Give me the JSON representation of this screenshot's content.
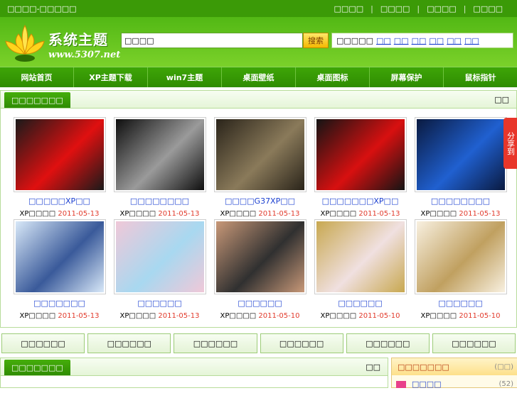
{
  "topbar": {
    "left_text": "□□□□-□□□□□",
    "links": [
      "□□□□",
      "□□□□",
      "□□□□",
      "□□□□"
    ]
  },
  "header": {
    "logo_title": "系统主题",
    "logo_domain": "www.5307.net",
    "search_value": "□□□□",
    "search_button": "搜索",
    "hot_label": "□□□□□",
    "hot_keywords": [
      "□□",
      "□□",
      "□□",
      "□□",
      "□□",
      "□□"
    ]
  },
  "nav": [
    "网站首页",
    "XP主题下载",
    "win7主题",
    "桌面壁纸",
    "桌面图标",
    "屏幕保护",
    "鼠标指针"
  ],
  "panel1": {
    "tab": "□□□□□□□",
    "more": "□□",
    "items": [
      {
        "name": "□□□□□XP□□",
        "type": "XP□□□□",
        "date": "2011-05-13",
        "color1": "#e01010",
        "color2": "#1a1a1a"
      },
      {
        "name": "□□□□□□□□",
        "type": "XP□□□□",
        "date": "2011-05-13",
        "color1": "#9a9a9a",
        "color2": "#0f0f0f"
      },
      {
        "name": "□□□□G37XP□□",
        "type": "XP□□□□",
        "date": "2011-05-13",
        "color1": "#8a7a5a",
        "color2": "#2a241a"
      },
      {
        "name": "□□□□□□□XP□□",
        "type": "XP□□□□",
        "date": "2011-05-13",
        "color1": "#d81010",
        "color2": "#141414"
      },
      {
        "name": "□□□□□□□□",
        "type": "XP□□□□",
        "date": "2011-05-13",
        "color1": "#2060d0",
        "color2": "#0a1a40"
      },
      {
        "name": "□□□□□□□",
        "type": "XP□□□□",
        "date": "2011-05-13",
        "color1": "#3a5a9a",
        "color2": "#d8e8f8"
      },
      {
        "name": "□□□□□□",
        "type": "XP□□□□",
        "date": "2011-05-13",
        "color1": "#a8d8f0",
        "color2": "#f0c8d8"
      },
      {
        "name": "□□□□□□",
        "type": "XP□□□□",
        "date": "2011-05-10",
        "color1": "#303030",
        "color2": "#c89878"
      },
      {
        "name": "□□□□□□",
        "type": "XP□□□□",
        "date": "2011-05-10",
        "color1": "#f0e0e0",
        "color2": "#c8a850"
      },
      {
        "name": "□□□□□□",
        "type": "XP□□□□",
        "date": "2011-05-10",
        "color1": "#c0a060",
        "color2": "#f8f0e0"
      }
    ]
  },
  "share": "分享到",
  "categories": [
    "□□□□□□",
    "□□□□□□",
    "□□□□□□",
    "□□□□□□",
    "□□□□□□",
    "□□□□□□"
  ],
  "panel2": {
    "tab": "□□□□□□□",
    "more": "□□"
  },
  "sidebar": {
    "title": "□□□□□□□",
    "count": "(□□)",
    "row_text": "□□□□",
    "row_num": "(52)"
  },
  "colors": {
    "brand_green": "#3b9a07",
    "link_blue": "#1a3fd0",
    "date_red": "#e23b2c"
  }
}
